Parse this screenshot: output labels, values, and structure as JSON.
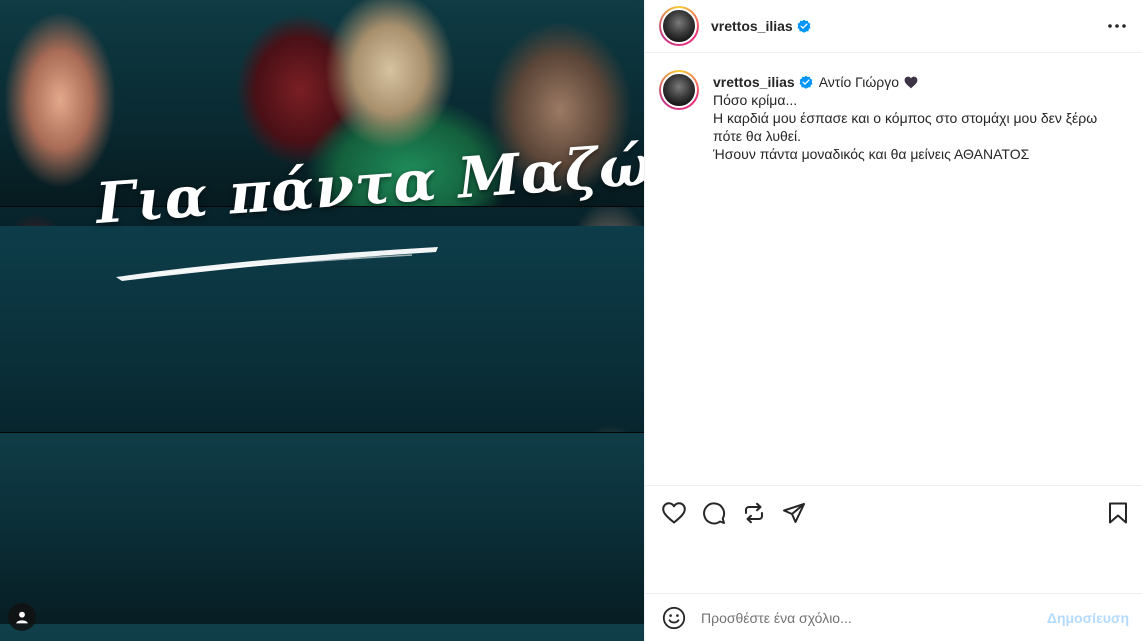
{
  "post": {
    "username": "vrettos_ilias",
    "verified": true,
    "media": {
      "overlay_title": "Για πάντα Μαζώ"
    }
  },
  "caption": {
    "username": "vrettos_ilias",
    "first_line": "Αντίο Γιώργο",
    "emoji": "black-heart",
    "lines": [
      "Πόσο κρίμα...",
      "Η καρδιά μου έσπασε και ο κόμπος στο στομάχι μου δεν ξέρω",
      "πότε θα λυθεί.",
      "Ήσουν πάντα μοναδικός και θα μείνεις ΑΘΑΝΑΤΟΣ"
    ]
  },
  "actions": {
    "icons": [
      "heart-icon",
      "comment-icon",
      "repost-icon",
      "share-icon",
      "bookmark-icon"
    ]
  },
  "comment": {
    "placeholder": "Προσθέστε ένα σχόλιο...",
    "post_label": "Δημοσίευση"
  },
  "colors": {
    "verified_blue": "#0095f6",
    "post_button_disabled": "#b3dbff",
    "text": "#262626",
    "muted": "#737373"
  }
}
